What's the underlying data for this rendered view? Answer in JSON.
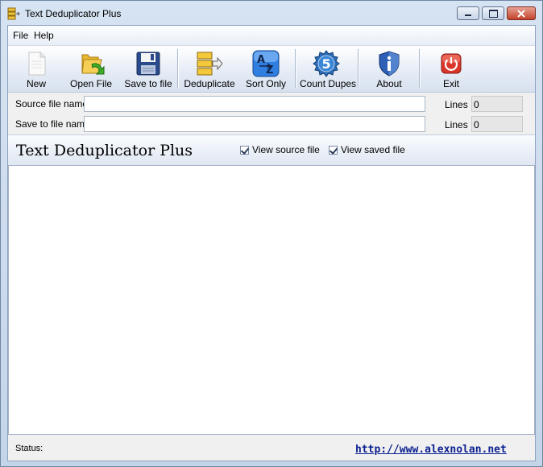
{
  "window": {
    "title": "Text Deduplicator Plus"
  },
  "menu": {
    "file": "File",
    "help": "Help"
  },
  "toolbar": {
    "new": "New",
    "open": "Open File",
    "save": "Save to file",
    "dedup": "Deduplicate",
    "sort": "Sort Only",
    "count": "Count Dupes",
    "about": "About",
    "exit": "Exit"
  },
  "source": {
    "label": "Source file name",
    "value": "",
    "lines_label": "Lines",
    "lines": "0"
  },
  "savefile": {
    "label": "Save to file name",
    "value": "",
    "lines_label": "Lines",
    "lines": "0"
  },
  "banner": {
    "title": "Text Deduplicator Plus",
    "view_source": "View source file",
    "view_saved": "View saved file"
  },
  "status": {
    "label": "Status:",
    "link": "http://www.alexnolan.net"
  },
  "icons": {
    "app": "app-icon",
    "new": "new-document-icon",
    "open": "open-folder-icon",
    "save": "floppy-disk-icon",
    "dedup": "deduplicate-icon",
    "sort": "sort-az-icon",
    "count": "count-badge-icon",
    "about": "info-shield-icon",
    "exit": "power-icon"
  }
}
